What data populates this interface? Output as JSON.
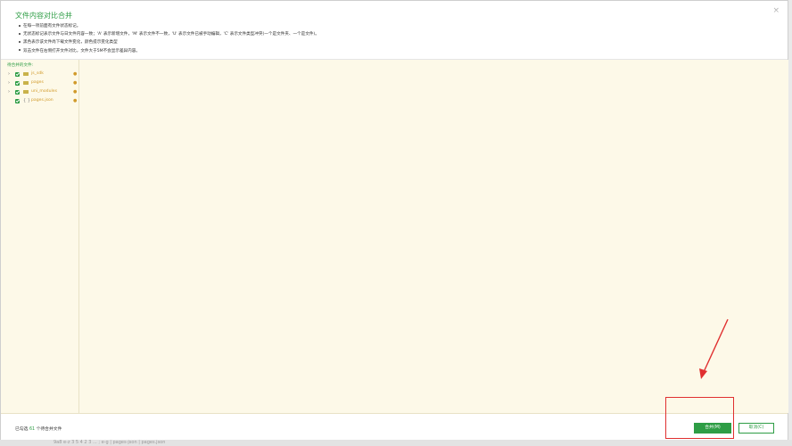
{
  "dialog": {
    "title": "文件内容对比合并",
    "close_glyph": "×",
    "tips": [
      "在每一项前面有文件状态标记。",
      "无状态标记表示文件与日文件内容一致；'A' 表示新增文件，'M' 表示文件不一致，'U' 表示文件已被手动编辑，'C' 表示文件类型冲突(一个是文件夹、一个是文件)。",
      "黑色表示该文件尚下载文件变化，颜色提示变化类型",
      "双击文件在右侧打开文件对比，文件大于5M不会显示差异内容。"
    ]
  },
  "left_panel": {
    "title": "待合并的文件:",
    "items": [
      {
        "label": "js_sdk",
        "arrow": "›",
        "status": "●",
        "type": "folder"
      },
      {
        "label": "pages",
        "arrow": "›",
        "status": "●",
        "type": "folder"
      },
      {
        "label": "uni_modules",
        "arrow": "›",
        "status": "●",
        "type": "folder"
      },
      {
        "label": "pages.json",
        "arrow": "",
        "status": "●",
        "type": "file",
        "icon": "{ }"
      }
    ]
  },
  "footer": {
    "prefix": "已勾选",
    "count": "61",
    "suffix": "个待合并文件",
    "merge_label": "合并(M)",
    "cancel_label": "取消(C)"
  },
  "colors": {
    "accent": "#2e9d45",
    "panel_bg": "#fdf9e8",
    "modified": "#d19a2a",
    "annotation": "#e03030"
  },
  "background_strip": "9a8 e-z  3 5 4 2 3 ...  ;  e-g  |  pages-json | pages.json"
}
